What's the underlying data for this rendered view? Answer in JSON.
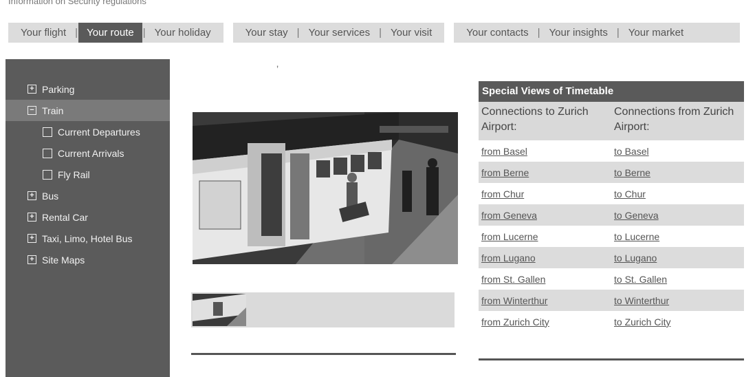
{
  "top_note": "Information on Security regulations",
  "nav": {
    "group1": [
      "Your flight",
      "Your route",
      "Your holiday"
    ],
    "group2": [
      "Your stay",
      "Your services",
      "Your visit"
    ],
    "group3": [
      "Your contacts",
      "Your insights",
      "Your market"
    ],
    "active": "Your route"
  },
  "subtitle_tick": "‚",
  "sidebar": {
    "items": [
      {
        "label": "Parking",
        "icon": "plus-box-icon"
      },
      {
        "label": "Train",
        "icon": "minus-box-icon",
        "active": true
      },
      {
        "label": "Current Departures",
        "icon": "empty-box-icon"
      },
      {
        "label": "Current Arrivals",
        "icon": "empty-box-icon"
      },
      {
        "label": "Fly Rail",
        "icon": "empty-box-icon"
      },
      {
        "label": "Bus",
        "icon": "plus-box-icon"
      },
      {
        "label": "Rental Car",
        "icon": "plus-box-icon"
      },
      {
        "label": "Taxi, Limo, Hotel Bus",
        "icon": "plus-box-icon"
      },
      {
        "label": "Site Maps",
        "icon": "plus-box-icon"
      }
    ]
  },
  "timetable": {
    "title": "Special Views of Timetable",
    "col_to": "Connections to Zurich Airport:",
    "col_from": "Connections from Zurich Airport:",
    "rows": [
      {
        "from": "from Basel",
        "to": "to Basel"
      },
      {
        "from": "from Berne",
        "to": "to Berne"
      },
      {
        "from": "from Chur",
        "to": "to Chur"
      },
      {
        "from": "from Geneva",
        "to": "to Geneva"
      },
      {
        "from": "from Lucerne",
        "to": "to Lucerne"
      },
      {
        "from": "from Lugano",
        "to": "to Lugano"
      },
      {
        "from": "from St. Gallen",
        "to": "to St. Gallen"
      },
      {
        "from": "from Winterthur",
        "to": "to Winterthur"
      },
      {
        "from": "from Zurich City",
        "to": "to Zurich City"
      }
    ]
  }
}
